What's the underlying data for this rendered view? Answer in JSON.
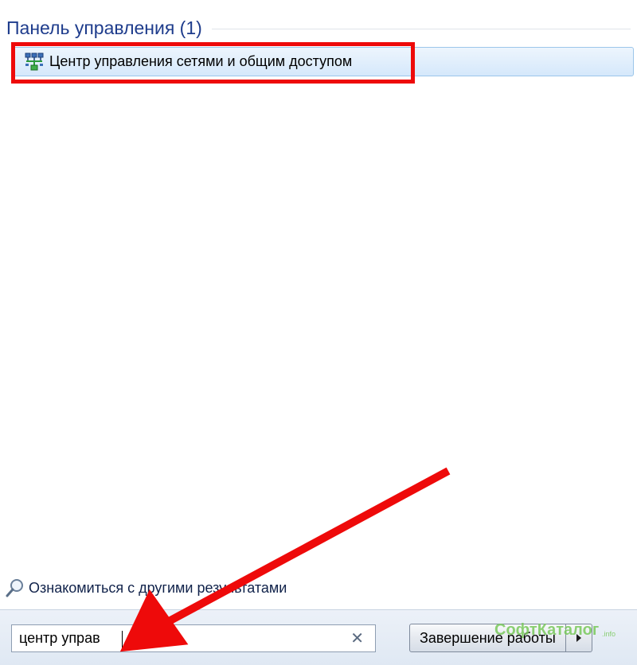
{
  "group": {
    "title": "Панель управления (1)"
  },
  "results": [
    {
      "label": "Центр управления сетями и общим доступом",
      "icon": "network-center-icon"
    }
  ],
  "more_results": {
    "label": "Ознакомиться с другими результатами",
    "icon": "magnifier-icon"
  },
  "search": {
    "value": "центр управ",
    "clear_glyph": "✕"
  },
  "shutdown": {
    "label": "Завершение работы",
    "arrow_icon": "triangle-right-icon"
  },
  "watermark": {
    "text": "СофтКаталог",
    "suffix": ".info"
  },
  "colors": {
    "highlight": "#ee0a0a",
    "arrow": "#ee0a0a",
    "header_text": "#1e3c8c",
    "selection": "#d5e8fb"
  }
}
